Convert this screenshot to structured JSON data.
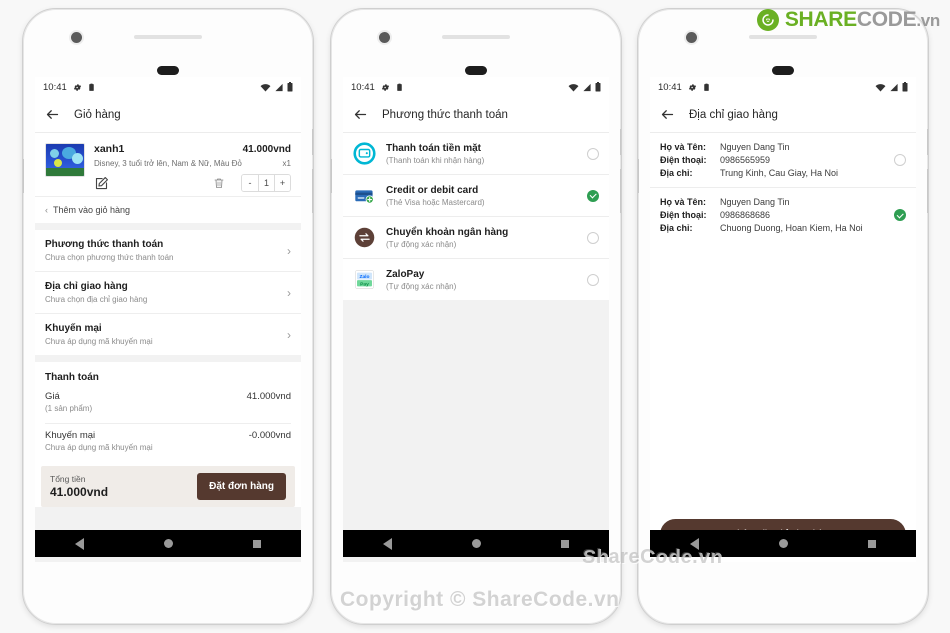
{
  "logo": {
    "part1": "SHARE",
    "part2": "CODE",
    "part3": ".vn",
    "accent": "#6ab023",
    "gray": "#9a9a9a"
  },
  "watermarks": {
    "middle": "ShareCode.vn",
    "bottom": "Copyright © ShareCode.vn"
  },
  "statusbar": {
    "time": "10:41"
  },
  "nav": {
    "back": "back-triangle",
    "home": "home-circle",
    "recents": "recents-square"
  },
  "phone1": {
    "appbar": {
      "title": "Giỏ hàng"
    },
    "cart_item": {
      "name": "xanh1",
      "price": "41.000vnd",
      "description": "Disney, 3 tuổi trở lên, Nam & Nữ, Màu Đỏ",
      "qty_label": "x1",
      "quantity": "1",
      "minus": "-",
      "plus": "+"
    },
    "add_more": {
      "chevron": "‹",
      "label": "Thêm vào giỏ hàng"
    },
    "options": [
      {
        "title": "Phương thức thanh toán",
        "subtitle": "Chưa chọn phương thức thanh toán",
        "chevron": "›"
      },
      {
        "title": "Địa chỉ giao hàng",
        "subtitle": "Chưa chọn địa chỉ giao hàng",
        "chevron": "›"
      },
      {
        "title": "Khuyến mại",
        "subtitle": "Chưa áp dụng mã khuyến mại",
        "chevron": "›"
      }
    ],
    "payment": {
      "heading": "Thanh toán",
      "price_label": "Giá",
      "price_value": "41.000vnd",
      "price_note": "(1 sản phẩm)",
      "promo_label": "Khuyến mại",
      "promo_value": "-0.000vnd",
      "promo_note": "Chưa áp dụng mã khuyến mại",
      "total_label": "Tổng tiền",
      "total_value": "41.000vnd",
      "order_button": "Đặt đơn hàng"
    }
  },
  "phone2": {
    "appbar": {
      "title": "Phương thức thanh toán"
    },
    "methods": [
      {
        "title": "Thanh toán tiền mặt",
        "subtitle": "(Thanh toán khi nhận hàng)",
        "icon": "wallet-icon",
        "selected": false
      },
      {
        "title": "Credit or debit card",
        "subtitle": "(Thẻ Visa hoặc Mastercard)",
        "icon": "credit-card-icon",
        "selected": true
      },
      {
        "title": "Chuyển khoản ngân hàng",
        "subtitle": "(Tự động xác nhận)",
        "icon": "bank-transfer-icon",
        "selected": false
      },
      {
        "title": "ZaloPay",
        "subtitle": "(Tự động xác nhận)",
        "icon": "zalopay-icon",
        "selected": false
      }
    ]
  },
  "phone3": {
    "appbar": {
      "title": "Địa chỉ giao hàng"
    },
    "labels": {
      "name": "Họ và Tên:",
      "phone": "Điện thoại:",
      "address": "Địa chỉ:"
    },
    "addresses": [
      {
        "name": "Nguyen Dang Tin",
        "phone": "0986565959",
        "address": "Trung Kinh, Cau Giay, Ha Noi",
        "selected": false
      },
      {
        "name": "Nguyen Dang Tin",
        "phone": "0986868686",
        "address": "Chuong Duong, Hoan Kiem, Ha Noi",
        "selected": true
      }
    ],
    "add_button": "Thêm địa chỉ giao hàng"
  }
}
